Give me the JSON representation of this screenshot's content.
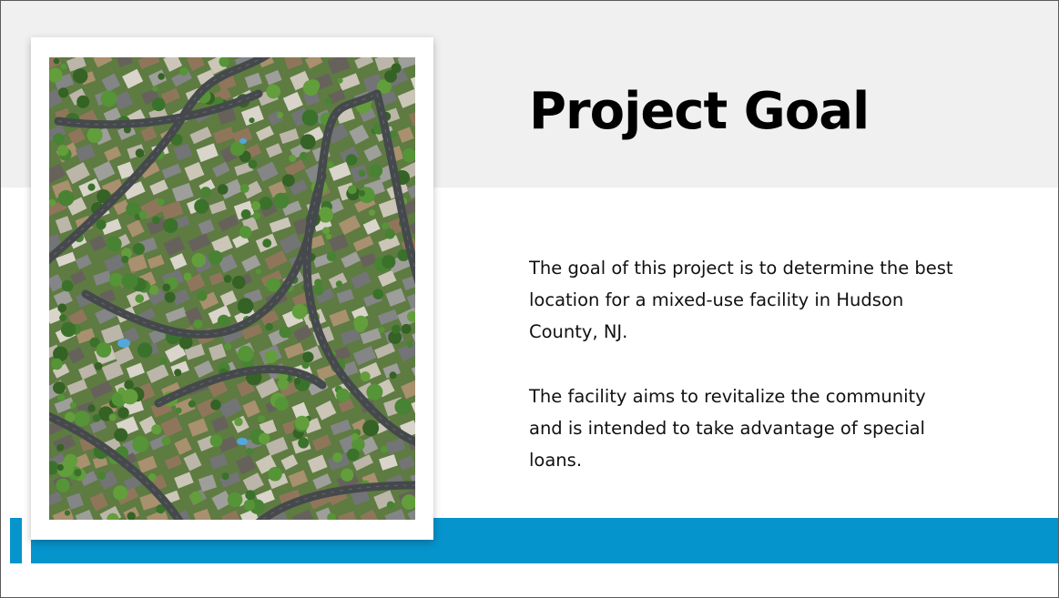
{
  "slide": {
    "title": "Project Goal",
    "paragraphs": [
      "The goal of this project is to determine the best location for a mixed-use facility in Hudson County, NJ.",
      "The facility aims to revitalize the community and is intended to take advantage of special loans."
    ]
  },
  "colors": {
    "accent_blue": "#0694cc",
    "top_band": "#f0f0f0",
    "text": "#000000"
  }
}
